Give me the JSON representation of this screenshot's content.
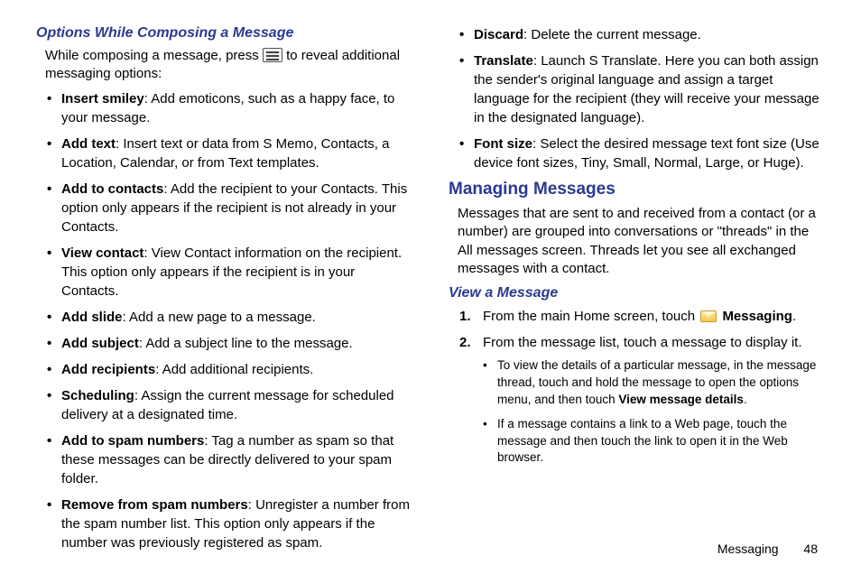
{
  "left": {
    "heading": "Options While Composing a Message",
    "intro_before": "While composing a message, press ",
    "intro_after": " to reveal additional messaging options:",
    "items": [
      {
        "term": "Insert smiley",
        "desc": ": Add emoticons, such as a happy face, to your message."
      },
      {
        "term": "Add text",
        "desc": ": Insert text or data from S Memo, Contacts, a Location, Calendar, or from Text templates."
      },
      {
        "term": "Add to contacts",
        "desc": ": Add the recipient to your Contacts. This option only appears if the recipient is not already in your Contacts."
      },
      {
        "term": "View contact",
        "desc": ": View Contact information on the recipient. This option only appears if the recipient is in your Contacts."
      },
      {
        "term": "Add slide",
        "desc": ": Add a new page to a message."
      },
      {
        "term": "Add subject",
        "desc": ": Add a subject line to the message."
      },
      {
        "term": "Add recipients",
        "desc": ": Add additional recipients."
      },
      {
        "term": "Scheduling",
        "desc": ": Assign the current message for scheduled delivery at a designated time."
      },
      {
        "term": "Add to spam numbers",
        "desc": ": Tag a number as spam so that these messages can be directly delivered to your spam folder."
      },
      {
        "term": "Remove from spam numbers",
        "desc": ": Unregister a number from the spam number list. This option only appears if the number was previously registered as spam."
      }
    ]
  },
  "right": {
    "cont_items": [
      {
        "term": "Discard",
        "desc": ": Delete the current message."
      },
      {
        "term": "Translate",
        "desc": ": Launch S Translate. Here you can both assign the sender's original language and assign a target language for the recipient (they will receive your message in the designated language)."
      },
      {
        "term": "Font size",
        "desc": ": Select the desired message text font size (Use device font sizes, Tiny, Small, Normal, Large, or Huge)."
      }
    ],
    "section": "Managing Messages",
    "section_intro": "Messages that are sent to and received from a contact (or a number) are grouped into conversations or \"threads\" in the All messages screen. Threads let you see all exchanged messages with a contact.",
    "sub": "View a Message",
    "step1_before": "From the main Home screen, touch ",
    "step1_bold": "Messaging",
    "step1_after": ".",
    "step2": "From the message list, touch a message to display it.",
    "sub_bullets": [
      {
        "pre": "To view the details of a particular message, in the message thread, touch and hold the message to open the options menu, and then touch ",
        "bold": "View message details",
        "post": "."
      },
      {
        "pre": "If a message contains a link to a Web page, touch the message and then touch the link to open it in the Web browser.",
        "bold": "",
        "post": ""
      }
    ]
  },
  "footer": {
    "section": "Messaging",
    "page": "48"
  }
}
